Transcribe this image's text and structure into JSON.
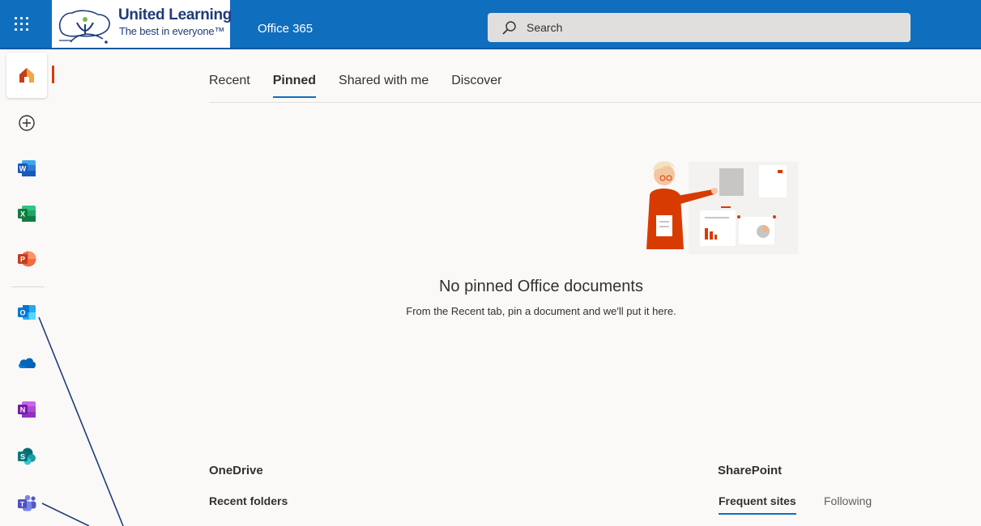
{
  "header": {
    "waffle_icon": "app-launcher-icon",
    "logo_title": "United Learning",
    "logo_tagline": "The best in everyone™",
    "app_name": "Office 365",
    "search_placeholder": "Search",
    "colors": {
      "bar": "#106ebe",
      "logo_text": "#1f3b7a"
    }
  },
  "rail": {
    "items": [
      {
        "name": "home",
        "icon": "home-icon",
        "active": true
      },
      {
        "name": "create",
        "icon": "add-circle-icon"
      },
      {
        "name": "word",
        "icon": "word-icon",
        "letter": "W"
      },
      {
        "name": "excel",
        "icon": "excel-icon",
        "letter": "X"
      },
      {
        "name": "powerpoint",
        "icon": "powerpoint-icon",
        "letter": "P"
      },
      {
        "name": "outlook",
        "icon": "outlook-icon",
        "letter": "O"
      },
      {
        "name": "onedrive",
        "icon": "onedrive-icon"
      },
      {
        "name": "onenote",
        "icon": "onenote-icon",
        "letter": "N"
      },
      {
        "name": "sharepoint",
        "icon": "sharepoint-icon",
        "letter": "S"
      },
      {
        "name": "teams",
        "icon": "teams-icon",
        "letter": "T"
      }
    ],
    "active_color": "#d83b01"
  },
  "tabs": [
    {
      "label": "Recent"
    },
    {
      "label": "Pinned",
      "active": true
    },
    {
      "label": "Shared with me"
    },
    {
      "label": "Discover"
    }
  ],
  "empty_state": {
    "title": "No pinned Office documents",
    "description": "From the Recent tab, pin a document and we'll put it here."
  },
  "onedrive": {
    "heading": "OneDrive",
    "subheading": "Recent folders"
  },
  "sharepoint": {
    "heading": "SharePoint",
    "tabs": [
      {
        "label": "Frequent sites",
        "active": true
      },
      {
        "label": "Following"
      }
    ]
  }
}
